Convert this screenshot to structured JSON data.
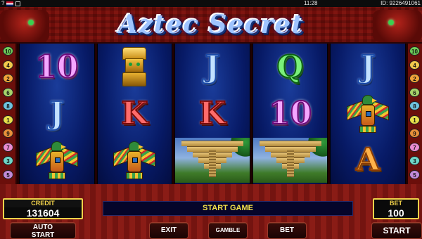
{
  "status_bar": {
    "time": "11:28",
    "id_text": "ID: 9226491061",
    "help_label": "?"
  },
  "game": {
    "title": "Aztec Secret"
  },
  "paylines": {
    "left": [
      {
        "label": "10",
        "color": "#6fcf5a"
      },
      {
        "label": "4",
        "color": "#f2c94c"
      },
      {
        "label": "2",
        "color": "#f2a33a"
      },
      {
        "label": "6",
        "color": "#a7d36a"
      },
      {
        "label": "8",
        "color": "#6fc3df"
      },
      {
        "label": "1",
        "color": "#e9de4a"
      },
      {
        "label": "9",
        "color": "#e8903a"
      },
      {
        "label": "7",
        "color": "#e98bd1"
      },
      {
        "label": "3",
        "color": "#6fd6c7"
      },
      {
        "label": "5",
        "color": "#c28ad8"
      }
    ],
    "right": [
      {
        "label": "10",
        "color": "#6fcf5a"
      },
      {
        "label": "4",
        "color": "#f2c94c"
      },
      {
        "label": "2",
        "color": "#f2a33a"
      },
      {
        "label": "6",
        "color": "#a7d36a"
      },
      {
        "label": "8",
        "color": "#6fc3df"
      },
      {
        "label": "1",
        "color": "#e9de4a"
      },
      {
        "label": "9",
        "color": "#e8903a"
      },
      {
        "label": "7",
        "color": "#e98bd1"
      },
      {
        "label": "3",
        "color": "#6fd6c7"
      },
      {
        "label": "5",
        "color": "#c28ad8"
      }
    ]
  },
  "reels": [
    {
      "symbols": [
        {
          "kind": "ten",
          "text": "10"
        },
        {
          "kind": "j",
          "text": "J"
        },
        {
          "kind": "bird",
          "icon": "quetzal-bird"
        }
      ]
    },
    {
      "symbols": [
        {
          "kind": "idol",
          "icon": "golden-idol"
        },
        {
          "kind": "k",
          "text": "K"
        },
        {
          "kind": "bird",
          "icon": "quetzal-bird"
        }
      ]
    },
    {
      "symbols": [
        {
          "kind": "j",
          "text": "J"
        },
        {
          "kind": "k",
          "text": "K"
        },
        {
          "kind": "pyramid",
          "icon": "pyramid"
        }
      ]
    },
    {
      "symbols": [
        {
          "kind": "q",
          "text": "Q"
        },
        {
          "kind": "ten",
          "text": "10"
        },
        {
          "kind": "pyramid",
          "icon": "pyramid"
        }
      ]
    },
    {
      "symbols": [
        {
          "kind": "j",
          "text": "J"
        },
        {
          "kind": "bird",
          "icon": "quetzal-bird"
        },
        {
          "kind": "a",
          "text": "A"
        }
      ]
    }
  ],
  "credit": {
    "label": "CREDIT",
    "value": "131604"
  },
  "bet": {
    "label": "BET",
    "value": "100"
  },
  "message": "START GAME",
  "buttons": {
    "auto_line1": "AUTO",
    "auto_line2": "START",
    "exit": "EXIT",
    "gamble": "GAMBLE",
    "bet": "BET",
    "start": "START"
  }
}
